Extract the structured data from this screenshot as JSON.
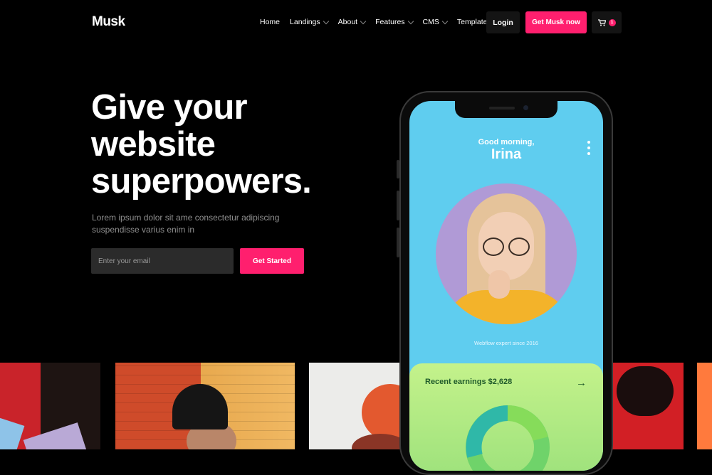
{
  "brand": {
    "logo": "Musk",
    "accent": "#ff1f6e"
  },
  "nav": {
    "items": [
      {
        "label": "Home",
        "dropdown": false
      },
      {
        "label": "Landings",
        "dropdown": true
      },
      {
        "label": "About",
        "dropdown": true
      },
      {
        "label": "Features",
        "dropdown": true
      },
      {
        "label": "CMS",
        "dropdown": true
      },
      {
        "label": "Template",
        "dropdown": true
      }
    ],
    "login_label": "Login",
    "cta_label": "Get Musk now",
    "cart_count": "1",
    "cart_icon": "cart-icon"
  },
  "hero": {
    "title_line1": "Give your",
    "title_line2": "website",
    "title_line3": "superpowers.",
    "subtitle": "Lorem ipsum dolor sit ame consectetur adipiscing suspendisse varius enim in",
    "email_placeholder": "Enter your email",
    "submit_label": "Get Started"
  },
  "phone": {
    "greeting": "Good morning,",
    "name": "Irina",
    "caption": "Webflow expert since 2016",
    "earnings_label": "Recent earnings $2,628",
    "arrow": "→"
  }
}
